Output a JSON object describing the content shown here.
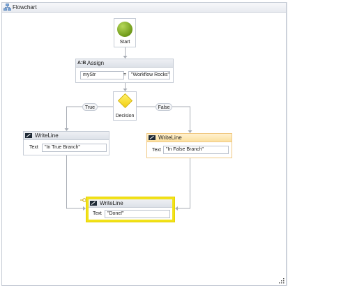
{
  "designer": {
    "title": "Flowchart"
  },
  "start": {
    "label": "Start"
  },
  "assign": {
    "title": "Assign",
    "icon_text": "A:B",
    "to": "myStr",
    "operator": "=",
    "value": "\"Workflow Rocks\""
  },
  "decision": {
    "label": "Decision",
    "true_label": "True",
    "false_label": "False"
  },
  "writeline_true": {
    "title": "WriteLine",
    "field_label": "Text",
    "text": "\"In True Branch\""
  },
  "writeline_false": {
    "title": "WriteLine",
    "field_label": "Text",
    "text": "\"In False Branch\""
  },
  "writeline_done": {
    "title": "WriteLine",
    "field_label": "Text",
    "text": "\"Done!\""
  },
  "colors": {
    "start": "#7aa521",
    "decision": "#f5d719",
    "selected_border": "#f2e21a",
    "hover_header": "#fbe0a0",
    "connector": "#a8adb5"
  }
}
